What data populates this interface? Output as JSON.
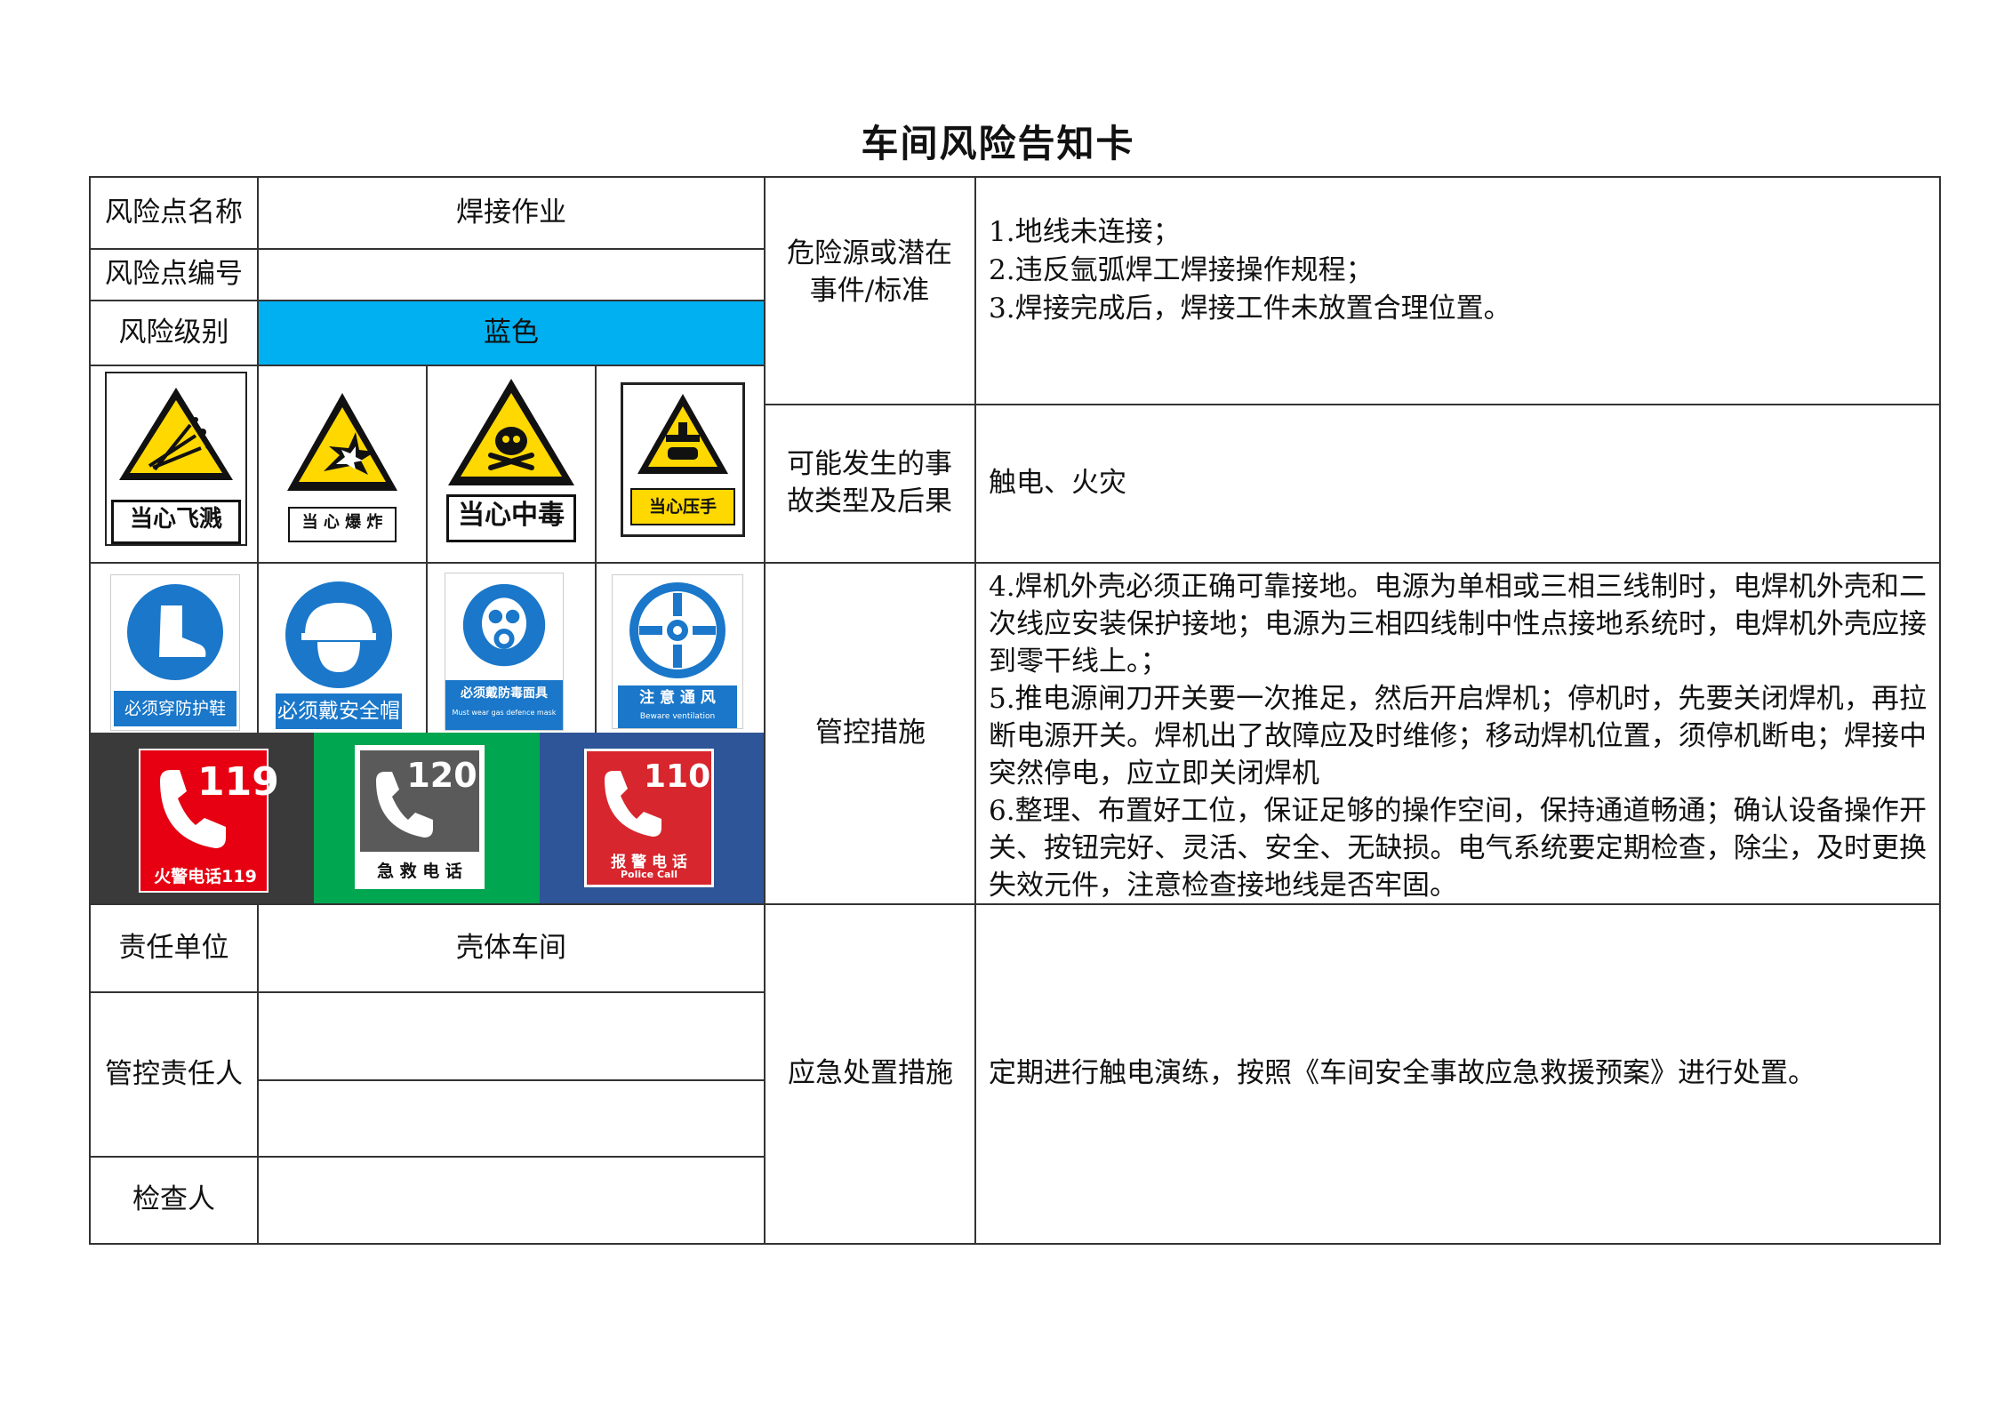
{
  "title": "车间风险告知卡",
  "left": {
    "risk_name_label": "风险点名称",
    "risk_name_value": "焊接作业",
    "risk_code_label": "风险点编号",
    "risk_code_value": "",
    "risk_level_label": "风险级别",
    "risk_level_value": "蓝色",
    "risk_level_color": "#00b0f0",
    "responsible_unit_label": "责任单位",
    "responsible_unit_value": "壳体车间",
    "control_person_label": "管控责任人",
    "control_person_value_1": "",
    "control_person_value_2": "",
    "inspector_label": "检查人",
    "inspector_value": ""
  },
  "warning_signs": [
    {
      "label": "当心飞溅",
      "icon": "splash-warning-icon"
    },
    {
      "label": "当 心 爆 炸",
      "icon": "explosion-warning-icon"
    },
    {
      "label": "当心中毒",
      "icon": "poison-warning-icon"
    },
    {
      "label": "当心压手",
      "icon": "crush-hand-warning-icon"
    }
  ],
  "mandatory_signs": [
    {
      "label": "必须穿防护鞋",
      "sublabel": "",
      "icon": "safety-boots-icon"
    },
    {
      "label": "必须戴安全帽",
      "sublabel": "",
      "icon": "safety-helmet-icon"
    },
    {
      "label": "必须戴防毒面具",
      "sublabel": "Must wear gas defence mask",
      "icon": "gas-mask-icon"
    },
    {
      "label": "注 意 通 风",
      "sublabel": "Beware ventilation",
      "icon": "ventilation-fan-icon"
    }
  ],
  "phone_signs": [
    {
      "number": "119",
      "label": "火警电话119",
      "sublabel": "",
      "bg": "#3a3a3a",
      "card": "#e60012",
      "icon": "fire-phone-icon"
    },
    {
      "number": "120",
      "label": "急 救 电 话",
      "sublabel": "",
      "bg": "#00a650",
      "card": "#5a5a5a",
      "icon": "ambulance-phone-icon"
    },
    {
      "number": "110",
      "label": "报 警 电 话",
      "sublabel": "Police Call",
      "bg": "#2e5597",
      "card": "#d7262d",
      "icon": "police-phone-icon"
    }
  ],
  "right": {
    "hazard_label": "危险源或潜在事件/标准",
    "hazard_items": "1.地线未连接；\n2.违反氩弧焊工焊接操作规程；\n3.焊接完成后，焊接工件未放置合理位置。",
    "accident_label": "可能发生的事故类型及后果",
    "accident_value": "触电、火灾",
    "control_label": "管控措施",
    "control_items": "4.焊机外壳必须正确可靠接地。电源为单相或三相三线制时，电焊机外壳和二次线应安装保护接地；电源为三相四线制中性点接地系统时，电焊机外壳应接到零干线上。；\n5.推电源闸刀开关要一次推足，然后开启焊机；停机时，先要关闭焊机，再拉断电源开关。焊机出了故障应及时维修；移动焊机位置，须停机断电；焊接中突然停电，应立即关闭焊机\n6.整理、布置好工位，保证足够的操作空间，保持通道畅通；确认设备操作开关、按钮完好、灵活、安全、无缺损。电气系统要定期检查，除尘，及时更换失效元件，注意检查接地线是否牢固。",
    "emergency_label": "应急处置措施",
    "emergency_value": "定期进行触电演练，按照《车间安全事故应急救援预案》进行处置。"
  }
}
